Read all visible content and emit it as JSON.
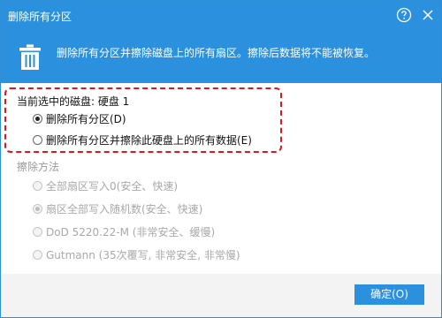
{
  "window": {
    "title": "删除所有分区"
  },
  "banner": {
    "icon": "trash-icon",
    "text": "删除所有分区并擦除磁盘上的所有扇区。擦除后数据将不能被恢复。"
  },
  "selection": {
    "current_disk_label": "当前选中的磁盘: 硬盘 1",
    "options": [
      {
        "label": "删除所有分区(D)",
        "checked": true
      },
      {
        "label": "删除所有分区并擦除此硬盘上的所有数据(E)",
        "checked": false
      }
    ]
  },
  "wipe": {
    "section_label": "擦除方法",
    "methods": [
      {
        "label": "全部扇区写入0(安全、快速)",
        "checked": false,
        "enabled": false
      },
      {
        "label": "扇区全部写入随机数(安全、快速)",
        "checked": true,
        "enabled": false
      },
      {
        "label": "DoD 5220.22-M (非常安全、缓慢)",
        "checked": false,
        "enabled": false
      },
      {
        "label": "Gutmann (35次覆写, 非常安全, 非常慢)",
        "checked": false,
        "enabled": false
      }
    ]
  },
  "footer": {
    "ok_label": "确定(O)"
  },
  "colors": {
    "accent": "#2b91df",
    "highlight_border": "#e0161f"
  }
}
